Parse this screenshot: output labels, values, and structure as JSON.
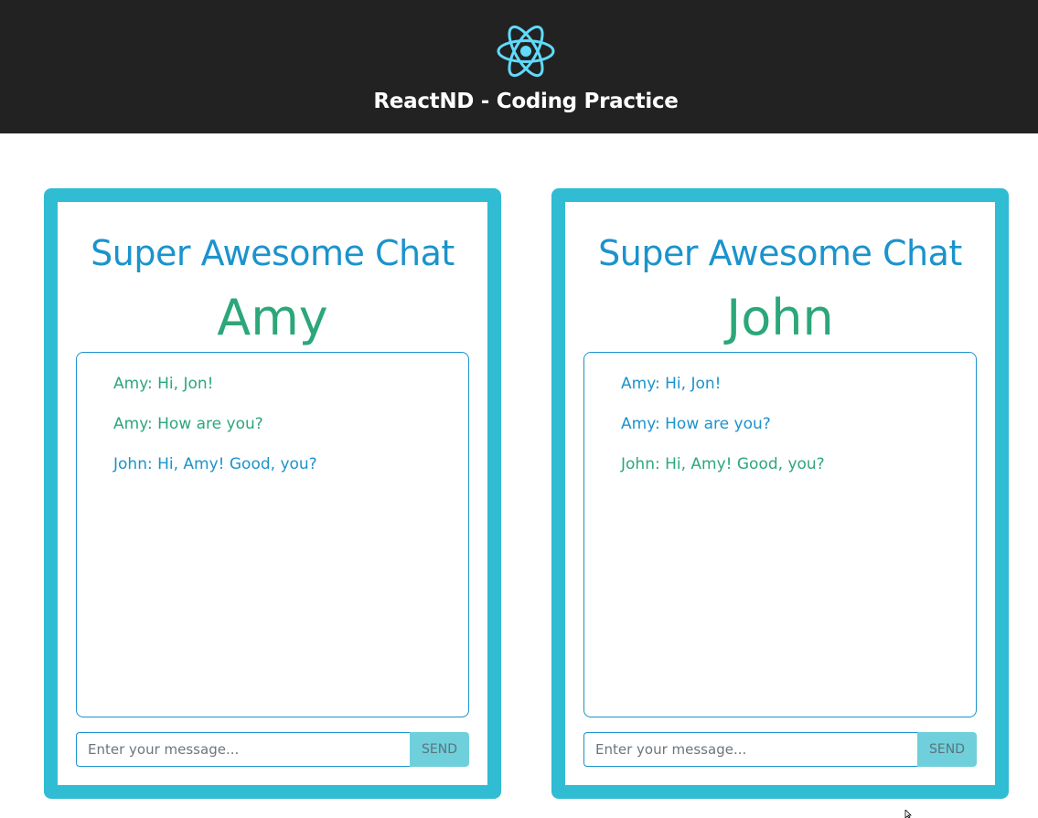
{
  "header": {
    "logo_icon": "react-atom-icon",
    "title": "ReactND - Coding Practice",
    "background": "#222222",
    "logo_color": "#61dafb"
  },
  "chats": [
    {
      "heading": "Super Awesome Chat",
      "user": "Amy",
      "messages": [
        {
          "text": "Amy: Hi, Jon!",
          "from_self": true
        },
        {
          "text": "Amy: How are you?",
          "from_self": true
        },
        {
          "text": "John: Hi, Amy! Good, you?",
          "from_self": false
        }
      ],
      "input": {
        "value": "",
        "placeholder": "Enter your message..."
      },
      "send_label": "SEND"
    },
    {
      "heading": "Super Awesome Chat",
      "user": "John",
      "messages": [
        {
          "text": "Amy: Hi, Jon!",
          "from_self": false
        },
        {
          "text": "Amy: How are you?",
          "from_self": false
        },
        {
          "text": "John: Hi, Amy! Good, you?",
          "from_self": true
        }
      ],
      "input": {
        "value": "",
        "placeholder": "Enter your message..."
      },
      "send_label": "SEND"
    }
  ],
  "colors": {
    "frame": "#30bcd2",
    "heading": "#1b93cc",
    "self_message": "#2ca77a",
    "other_message": "#1b93cc",
    "send_button": "#6fd0dc"
  }
}
